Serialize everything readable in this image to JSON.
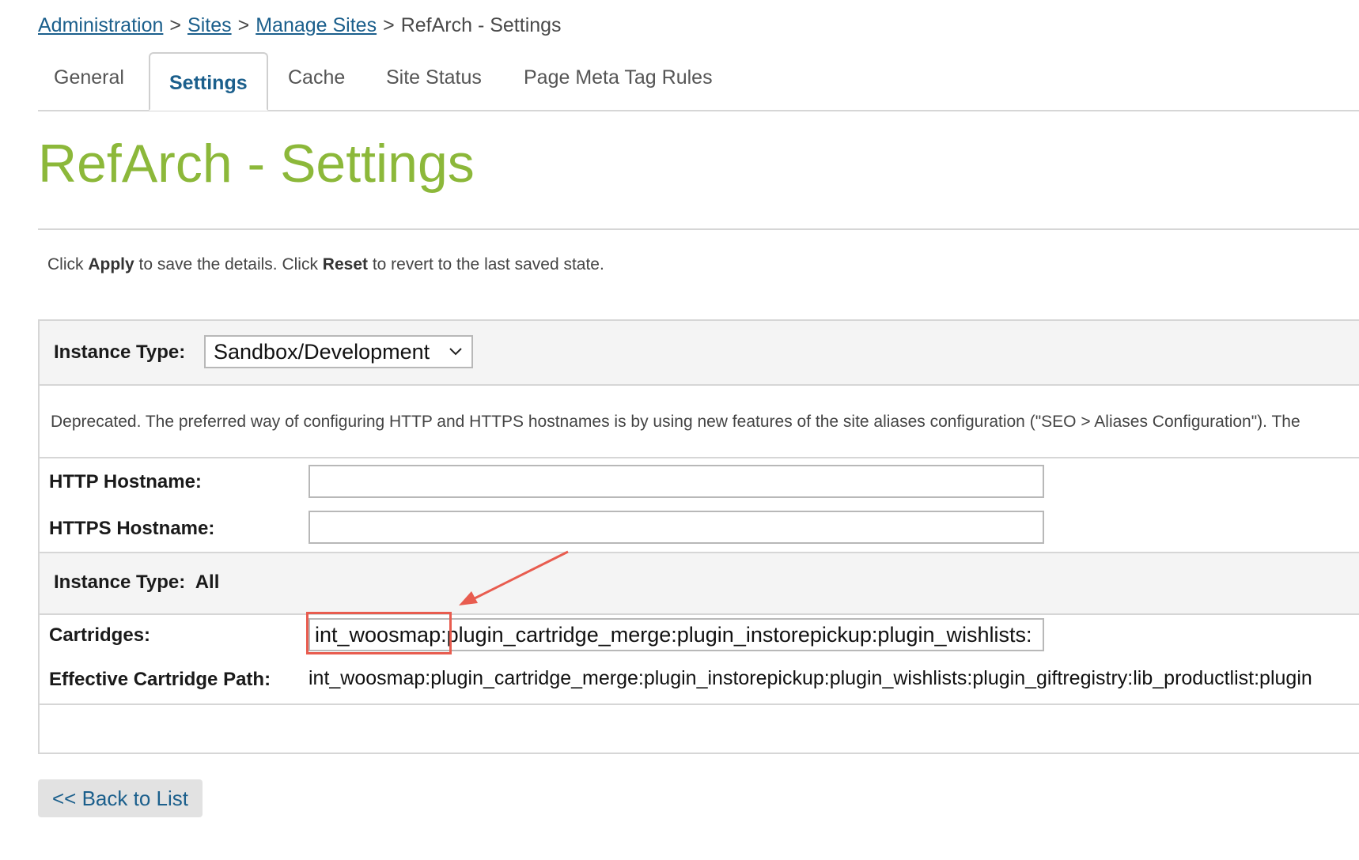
{
  "breadcrumb": {
    "items": [
      "Administration",
      "Sites",
      "Manage Sites"
    ],
    "separator": ">",
    "current": "RefArch - Settings"
  },
  "tabs": [
    {
      "label": "General",
      "active": false
    },
    {
      "label": "Settings",
      "active": true
    },
    {
      "label": "Cache",
      "active": false
    },
    {
      "label": "Site Status",
      "active": false
    },
    {
      "label": "Page Meta Tag Rules",
      "active": false
    }
  ],
  "page_title": "RefArch - Settings",
  "info": {
    "pre": "Click ",
    "apply": "Apply",
    "mid": " to save the details. Click ",
    "reset": "Reset",
    "post": " to revert to the last saved state."
  },
  "instance_type": {
    "label": "Instance Type:",
    "value": "Sandbox/Development"
  },
  "deprecated_text": "Deprecated. The preferred way of configuring HTTP and HTTPS hostnames is by using new features of the site aliases configuration (\"SEO > Aliases Configuration\"). The",
  "http_hostname": {
    "label": "HTTP Hostname:",
    "value": ""
  },
  "https_hostname": {
    "label": "HTTPS Hostname:",
    "value": ""
  },
  "instance_type_all": {
    "label": "Instance Type:",
    "value": "All"
  },
  "cartridges": {
    "label": "Cartridges:",
    "value": "int_woosmap:plugin_cartridge_merge:plugin_instorepickup:plugin_wishlists:"
  },
  "effective_path": {
    "label": "Effective Cartridge Path:",
    "value": "int_woosmap:plugin_cartridge_merge:plugin_instorepickup:plugin_wishlists:plugin_giftregistry:lib_productlist:plugin"
  },
  "back_button": "<< Back to List",
  "colors": {
    "link": "#1b5f8c",
    "title": "#8cb83a",
    "annotation": "#e85c4f",
    "band": "#f4f4f4"
  },
  "icons": {
    "select_arrow": "chevron-down-icon",
    "annotation_arrow": "arrow-icon"
  }
}
